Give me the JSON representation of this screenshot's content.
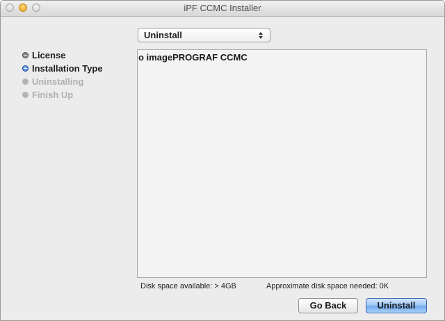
{
  "window": {
    "title": "iPF CCMC Installer"
  },
  "steps": [
    {
      "label": "License"
    },
    {
      "label": "Installation Type"
    },
    {
      "label": "Uninstalling"
    },
    {
      "label": "Finish Up"
    }
  ],
  "popup": {
    "selected": "Uninstall"
  },
  "list": {
    "items": [
      "o imagePROGRAF CCMC"
    ]
  },
  "status": {
    "disk_available": "Disk space available: > 4GB",
    "disk_needed": "Approximate disk space needed: 0K"
  },
  "buttons": {
    "back": "Go Back",
    "primary": "Uninstall"
  },
  "colors": {
    "window_background": "#ececec",
    "current_step_bullet": "#2a6fd6",
    "primary_button": "#6fa7ec"
  },
  "icons": {
    "window_controls": [
      "close-icon",
      "minimize-icon",
      "zoom-icon"
    ],
    "popup": "up-down-chevron-icon"
  }
}
